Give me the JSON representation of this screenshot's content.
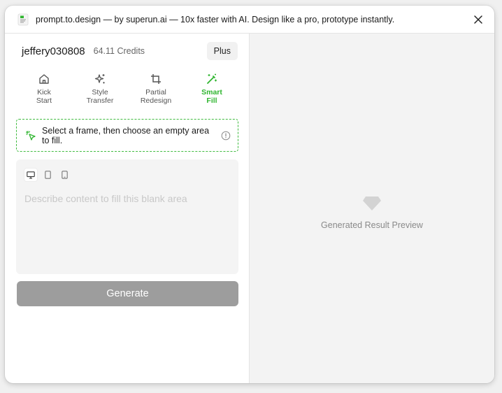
{
  "window": {
    "title": "prompt.to.design — by superun.ai — 10x faster with AI. Design like a pro, prototype instantly."
  },
  "user": {
    "name": "jeffery030808",
    "credits": "64.11 Credits",
    "plan": "Plus"
  },
  "modes": [
    {
      "label": "Kick\nStart",
      "icon": "home-icon",
      "active": false
    },
    {
      "label": "Style\nTransfer",
      "icon": "sparkles-icon",
      "active": false
    },
    {
      "label": "Partial\nRedesign",
      "icon": "crop-icon",
      "active": false
    },
    {
      "label": "Smart\nFill",
      "icon": "magic-wand-icon",
      "active": true
    }
  ],
  "hint": {
    "text": "Select a frame, then choose an empty area to fill."
  },
  "prompt": {
    "placeholder": "Describe content to fill this blank area",
    "value": "",
    "devices": [
      "desktop-icon",
      "tablet-icon",
      "phone-icon"
    ],
    "active_device": "desktop-icon"
  },
  "generate": {
    "label": "Generate"
  },
  "preview": {
    "label": "Generated Result Preview"
  },
  "colors": {
    "accent": "#2fb52f",
    "button_disabled": "#9d9d9d",
    "preview_bg": "#f3f3f3"
  }
}
